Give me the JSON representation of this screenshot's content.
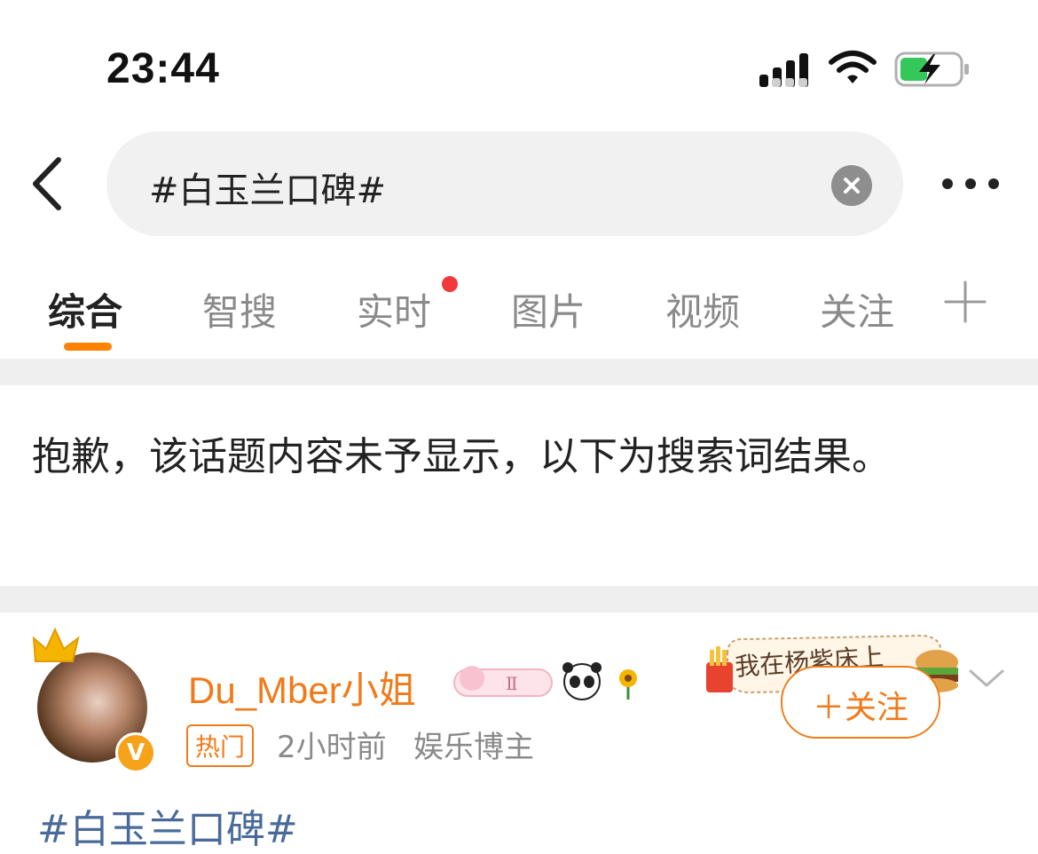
{
  "status_bar": {
    "time": "23:44",
    "battery_charging": true
  },
  "search": {
    "query": "#白玉兰口碑#"
  },
  "tabs": [
    {
      "label": "综合",
      "active": true
    },
    {
      "label": "智搜",
      "active": false
    },
    {
      "label": "实时",
      "active": false,
      "has_red_dot": true
    },
    {
      "label": "图片",
      "active": false
    },
    {
      "label": "视频",
      "active": false
    },
    {
      "label": "关注",
      "active": false
    }
  ],
  "notice": "抱歉，该话题内容未予显示，以下为搜索词结果。",
  "post": {
    "username": "Du_Mber小姐",
    "hot_tag": "热门",
    "time": "2小时前",
    "role": "娱乐博主",
    "decoration_text": "我在杨紫床上",
    "follow_label": "＋关注",
    "topic": "#白玉兰口碑#"
  },
  "colors": {
    "accent": "#f07b1a",
    "tab_underline": "#ff8200",
    "red_dot": "#f2393b",
    "topic_link": "#4a6b9a"
  },
  "icons": [
    "back-arrow-icon",
    "clear-icon",
    "more-icon",
    "plus-icon",
    "crown-icon",
    "verified-v-icon",
    "chevron-down-icon"
  ]
}
